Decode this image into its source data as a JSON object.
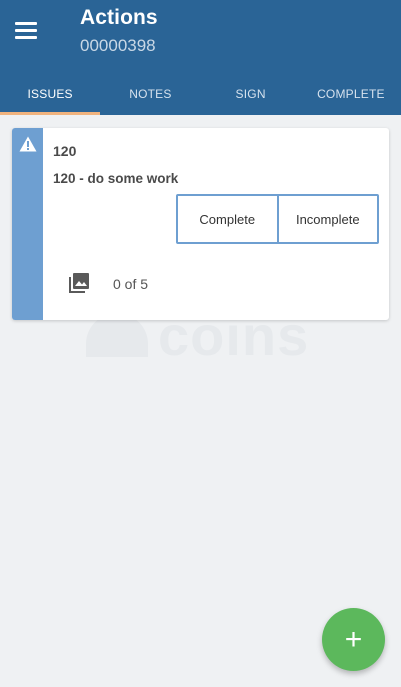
{
  "header": {
    "title": "Actions",
    "subtitle": "00000398",
    "menu_icon": "hamburger-menu-icon",
    "background": "#2a6496"
  },
  "tabs": [
    {
      "label": "ISSUES",
      "active": true
    },
    {
      "label": "NOTES",
      "active": false
    },
    {
      "label": "SIGN",
      "active": false
    },
    {
      "label": "COMPLETE",
      "active": false
    }
  ],
  "watermark": {
    "text": "coins"
  },
  "issue_card": {
    "status_icon": "warning-icon",
    "code": "120",
    "description": "120 - do some work",
    "buttons": {
      "complete": "Complete",
      "incomplete": "Incomplete"
    },
    "photo_icon": "photo-gallery-icon",
    "photo_count": "0 of 5",
    "accent_color": "#6e9fd1"
  },
  "fab": {
    "icon": "plus-icon",
    "label": "+",
    "color": "#5cb85c"
  }
}
